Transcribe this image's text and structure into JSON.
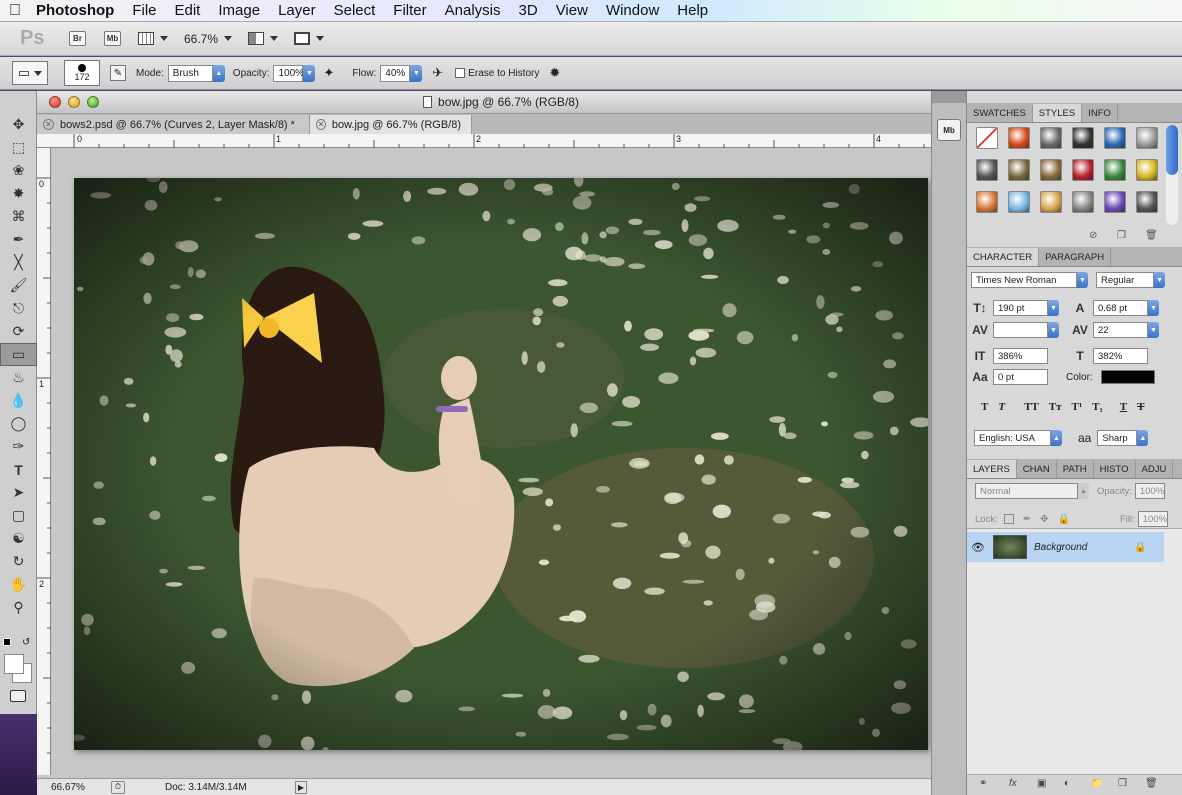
{
  "menubar": {
    "app": "Photoshop",
    "items": [
      "File",
      "Edit",
      "Image",
      "Layer",
      "Select",
      "Filter",
      "Analysis",
      "3D",
      "View",
      "Window",
      "Help"
    ]
  },
  "appbar": {
    "logo": "Ps",
    "bridge": "Br",
    "minibridge": "Mb",
    "zoom": "66.7%"
  },
  "options": {
    "brush_size": "172",
    "mode_label": "Mode:",
    "mode_value": "Brush",
    "opacity_label": "Opacity:",
    "opacity_value": "100%",
    "flow_label": "Flow:",
    "flow_value": "40%",
    "erase_history": "Erase to History"
  },
  "document": {
    "window_title": "bow.jpg @ 66.7% (RGB/8)",
    "tabs": [
      {
        "label": "bows2.psd @ 66.7% (Curves 2, Layer Mask/8) *"
      },
      {
        "label": "bow.jpg @ 66.7% (RGB/8)"
      }
    ],
    "ruler_top": [
      "0",
      "1",
      "2",
      "3",
      "4"
    ],
    "ruler_left": [
      "0",
      "1",
      "2"
    ],
    "status_zoom": "66.67%",
    "status_doc": "Doc: 3.14M/3.14M"
  },
  "swatches_panel": {
    "tabs": [
      "SWATCHES",
      "STYLES",
      "INFO"
    ]
  },
  "character_panel": {
    "tabs": [
      "CHARACTER",
      "PARAGRAPH"
    ],
    "font_family": "Times New Roman",
    "font_style": "Regular",
    "size": "190 pt",
    "leading": "0.68 pt",
    "kerning": "",
    "tracking": "22",
    "vscale": "386%",
    "hscale": "382%",
    "baseline": "0 pt",
    "color_label": "Color:",
    "color_value": "#000000",
    "language": "English: USA",
    "aa_symbol": "aa",
    "antialias": "Sharp"
  },
  "layers_panel": {
    "tabs": [
      "LAYERS",
      "CHAN",
      "PATH",
      "HISTO",
      "ADJU"
    ],
    "blend": "Normal",
    "opacity_label": "Opacity:",
    "opacity": "100%",
    "lock_label": "Lock:",
    "fill_label": "Fill:",
    "fill": "100%",
    "layer_name": "Background"
  }
}
